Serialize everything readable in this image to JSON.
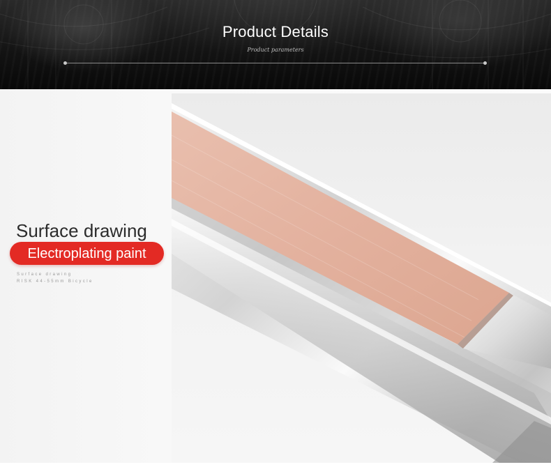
{
  "header": {
    "title": "Product Details",
    "subtitle": "Product parameters"
  },
  "feature": {
    "title": "Surface drawing",
    "highlight": "Electroplating paint",
    "fine_print_1": "Surface drawing",
    "fine_print_2": "RISK 44-55mm Bicycle"
  },
  "colors": {
    "accent_red": "#e32a24",
    "plate_rose": "#e6b5a3",
    "chrome": "#d9d9d9"
  }
}
